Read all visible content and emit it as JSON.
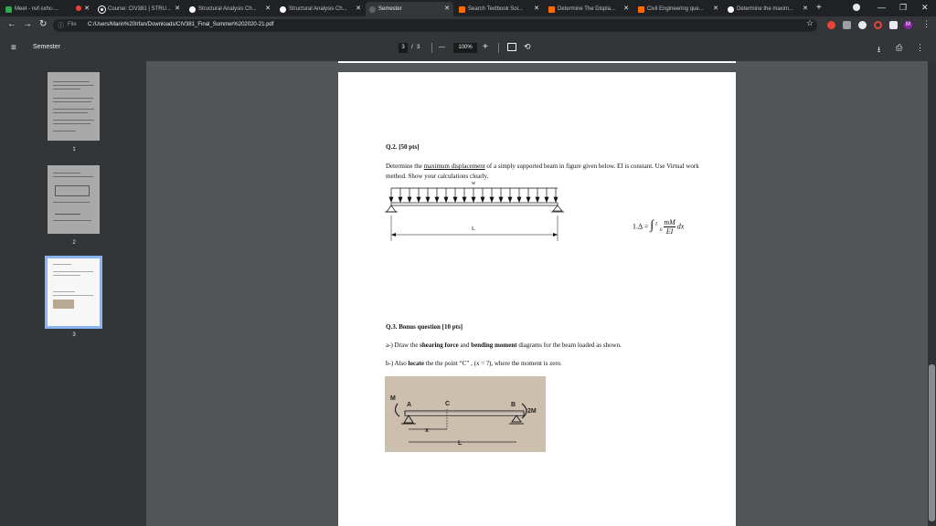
{
  "browser": {
    "tabs": [
      {
        "title": "Meet - nvf-sxhc-...",
        "color": "#34a853"
      },
      {
        "title": "Course: CIV381 | STRU...",
        "color": "#ffffff"
      },
      {
        "title": "Structural Analysis Ch...",
        "color": "#ffffff"
      },
      {
        "title": "Structural Analysis Ch...",
        "color": "#ffffff"
      },
      {
        "title": "Semester",
        "color": "#5f6368"
      },
      {
        "title": "Search Textbook Sol...",
        "color": "#ff6a00"
      },
      {
        "title": "Determine The Displa...",
        "color": "#ff6a00"
      },
      {
        "title": "Civil Engineering que...",
        "color": "#ff6a00"
      },
      {
        "title": "Determine the maxim...",
        "color": "#ffffff"
      }
    ],
    "active_tab_index": 4,
    "address": {
      "info_icon": "info-icon",
      "scheme_label": "File",
      "url": "C:/Users/Marin%20Irfan/Downloads/CIV381_Final_Summer%202020-21.pdf"
    },
    "profile_initial": "M"
  },
  "pdf_toolbar": {
    "title": "Semester",
    "current_page": "3",
    "separator": "/",
    "page_count": "3",
    "zoom_minus": "—",
    "zoom": "100%",
    "zoom_plus": "+"
  },
  "thumbnails": [
    {
      "number": "1",
      "selected": false
    },
    {
      "number": "2",
      "selected": false
    },
    {
      "number": "3",
      "selected": true
    }
  ],
  "document": {
    "q2": {
      "title": "Q.2. [50 pts]",
      "text_before": "Determine the ",
      "underlined": "maximum displacement",
      "text_after": " of a simply supported beam in figure given below. EI is constant. Use Virtual work method. Show your calculations clearly.",
      "load_label": "w",
      "span_label": "L",
      "formula_left": "1.Δ =",
      "formula_upper": "L",
      "formula_lower": "0",
      "formula_numerator": "mM",
      "formula_denominator": "EI",
      "formula_dx": "dx"
    },
    "q3": {
      "title": "Q.3. Bonus question [10 pts]",
      "a_prefix": "a-) Draw the ",
      "a_bold1": "shearing force",
      "a_mid": " and ",
      "a_bold2": "bending moment",
      "a_suffix": " diagrams for the beam loaded as shown.",
      "b_prefix": "b-) Also ",
      "b_bold": "locate",
      "b_suffix": " the the point “C” , (x = ?), where the moment is zero.",
      "fig_labels": {
        "M": "M",
        "A": "A",
        "C": "C",
        "B": "B",
        "moment": "2M",
        "x": "x",
        "L": "L"
      }
    }
  }
}
